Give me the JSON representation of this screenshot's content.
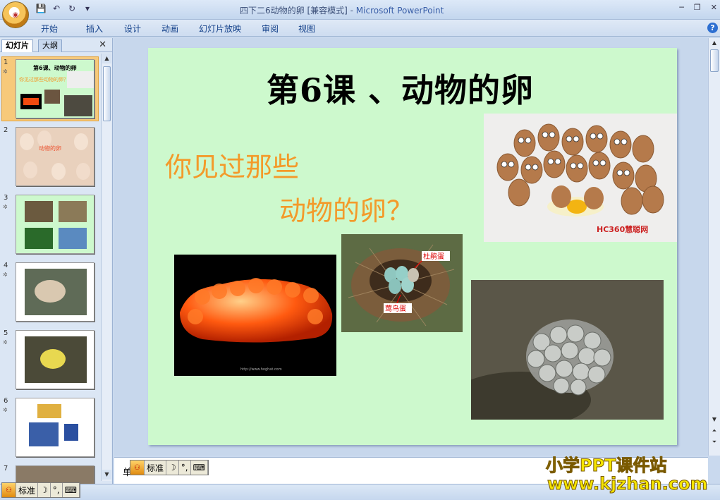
{
  "window": {
    "title": "四下二6动物的卵 [兼容模式] - ",
    "app_name": "Microsoft PowerPoint"
  },
  "quick_access": {
    "save_icon": "save-icon",
    "undo_icon": "undo-icon",
    "redo_icon": "redo-icon"
  },
  "ribbon": {
    "tabs": [
      "开始",
      "插入",
      "设计",
      "动画",
      "幻灯片放映",
      "审阅",
      "视图"
    ],
    "help_label": "?"
  },
  "left_panel": {
    "tab_slides": "幻灯片",
    "tab_outline": "大纲",
    "close_label": "✕",
    "slides": [
      {
        "num": "1",
        "has_star": true
      },
      {
        "num": "2",
        "has_star": false
      },
      {
        "num": "3",
        "has_star": true
      },
      {
        "num": "4",
        "has_star": true
      },
      {
        "num": "5",
        "has_star": true
      },
      {
        "num": "6",
        "has_star": true
      },
      {
        "num": "7",
        "has_star": false
      }
    ],
    "thumb_text": {
      "s1_title": "第6课、动物的卵",
      "s1_q": "你见过那些动物的卵？",
      "s2_title": "动物的卵"
    }
  },
  "slide": {
    "title": "第6课 、动物的卵",
    "question_line1": "你见过那些",
    "question_line2": "动物的卵？",
    "nest_label_top": "杜鹃蛋",
    "nest_label_bottom": "莺鸟蛋",
    "eggs_watermark": "HC360慧聪网",
    "roe_caption": "http://www.hoghat.com"
  },
  "notes": {
    "text": "单"
  },
  "ime": {
    "mode": "标准",
    "moon": "☽",
    "dots": "°,",
    "kbd": "⌨"
  },
  "watermark": {
    "line1": "小学PPT课件站",
    "line2": "www.kjzhan.com"
  },
  "colors": {
    "slide_bg": "#cdf9cd",
    "question": "#f39a2a",
    "watermark": "#f5e500"
  }
}
